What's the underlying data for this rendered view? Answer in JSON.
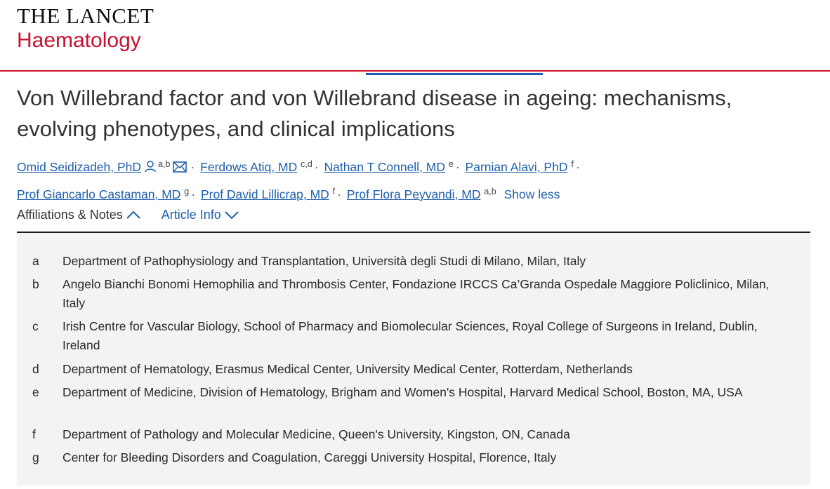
{
  "journal": {
    "name": "THE LANCET",
    "subtitle": "Haematology"
  },
  "article": {
    "title": "Von Willebrand factor and von Willebrand disease in ageing: mechanisms, evolving phenotypes, and clinical implications"
  },
  "authors": [
    {
      "name": "Omid Seidizadeh, PhD",
      "sup": "a,b"
    },
    {
      "name": "Ferdows Atiq, MD",
      "sup": "c,d"
    },
    {
      "name": "Nathan T Connell, MD",
      "sup": "e"
    },
    {
      "name": "Parnian Alavi, PhD",
      "sup": "f"
    },
    {
      "name": "Prof Giancarlo Castaman, MD",
      "sup": "g"
    },
    {
      "name": "Prof David Lillicrap, MD",
      "sup": "f"
    },
    {
      "name": "Prof Flora Peyvandi, MD",
      "sup": "a,b"
    }
  ],
  "separator": "·",
  "show_less": "Show less",
  "icons": {
    "person": "person-icon",
    "email": "email-icon",
    "chevron_up": "chevron-up-icon",
    "chevron_down": "chevron-down-icon"
  },
  "tabs": {
    "affiliations": "Affiliations & Notes",
    "article_info": "Article Info"
  },
  "affiliations": [
    {
      "key": "a",
      "text": "Department of Pathophysiology and Transplantation, Università degli Studi di Milano, Milan, Italy"
    },
    {
      "key": "b",
      "text": "Angelo Bianchi Bonomi Hemophilia and Thrombosis Center, Fondazione IRCCS Ca’Granda Ospedale Maggiore Policlinico, Milan, Italy"
    },
    {
      "key": "c",
      "text": "Irish Centre for Vascular Biology, School of Pharmacy and Biomolecular Sciences, Royal College of Surgeons in Ireland, Dublin, Ireland"
    },
    {
      "key": "d",
      "text": "Department of Hematology, Erasmus Medical Center, University Medical Center, Rotterdam, Netherlands"
    },
    {
      "key": "e",
      "text": "Department of Medicine, Division of Hematology, Brigham and Women's Hospital, Harvard Medical School, Boston, MA, USA"
    },
    {
      "key": "f",
      "text": "Department of Pathology and Molecular Medicine, Queen's University, Kingston, ON, Canada"
    },
    {
      "key": "g",
      "text": "Center for Bleeding Disorders and Coagulation, Careggi University Hospital, Florence, Italy"
    }
  ],
  "colors": {
    "brand_red": "#c8102e",
    "link_blue": "#1f5fad",
    "panel_bg": "#f3f3f3"
  }
}
